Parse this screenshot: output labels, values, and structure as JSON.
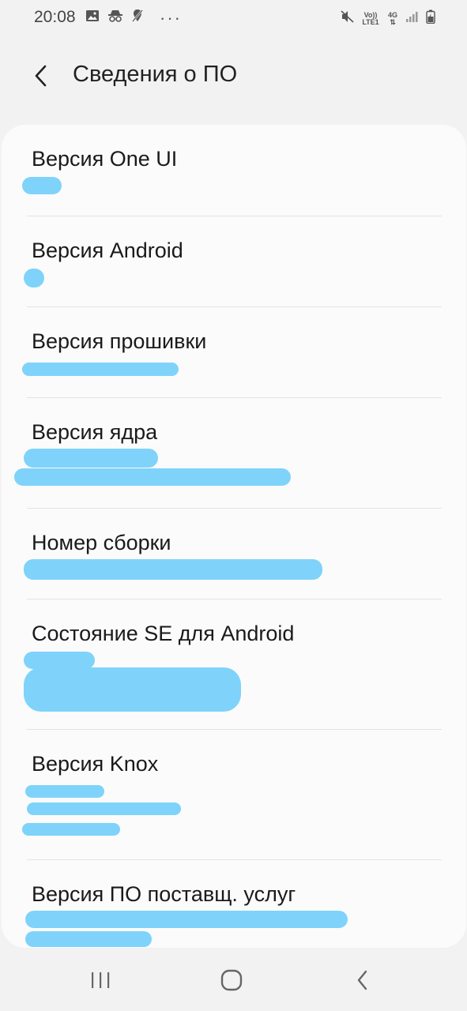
{
  "status_bar": {
    "time": "20:08",
    "network_top": "Vo)) LTE1",
    "network_4g": "4G"
  },
  "header": {
    "title": "Сведения о ПО"
  },
  "items": [
    {
      "label": "Версия One UI"
    },
    {
      "label": "Версия Android"
    },
    {
      "label": "Версия прошивки"
    },
    {
      "label": "Версия ядра"
    },
    {
      "label": "Номер сборки"
    },
    {
      "label": "Состояние SE для Android"
    },
    {
      "label": "Версия Knox"
    },
    {
      "label": "Версия ПО поставщ. услуг"
    }
  ],
  "colors": {
    "background": "#f2f2f2",
    "card": "#fbfbfb",
    "redaction": "#7fd3fa"
  },
  "icons": {
    "back": "chevron-left-icon",
    "recents": "recents-icon",
    "home": "home-icon",
    "nav_back": "nav-back-icon"
  }
}
